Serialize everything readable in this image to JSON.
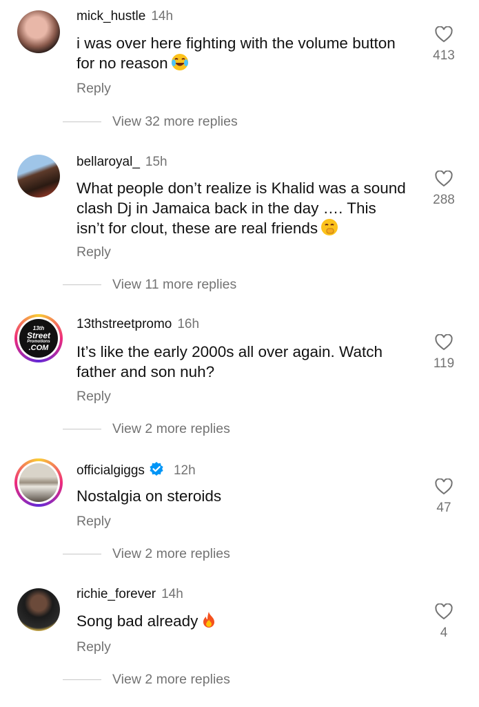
{
  "comments": [
    {
      "username": "mick_hustle",
      "time": "14h",
      "text": "i was over here fighting with the volume button for no reason",
      "emoji": "face-with-tears-of-joy",
      "reply": "Reply",
      "view_replies": "View 32 more replies",
      "likes": "413",
      "verified": false
    },
    {
      "username": "bellaroyal_",
      "time": "15h",
      "text": "What people don’t realize is Khalid was a sound clash Dj in Jamaica back in the day …. This isn’t for clout, these are real friends",
      "emoji": "face-with-hand-over-mouth",
      "reply": "Reply",
      "view_replies": "View 11 more replies",
      "likes": "288",
      "verified": false
    },
    {
      "username": "13thstreetpromo",
      "time": "16h",
      "text": "It’s like the early 2000s all over again. Watch father and son nuh?",
      "emoji": "",
      "reply": "Reply",
      "view_replies": "View 2 more replies",
      "likes": "119",
      "verified": false,
      "avatar_text": {
        "line1": "13th",
        "line2": "Street",
        "line3": "Promotions",
        "line4": ".COM"
      }
    },
    {
      "username": "officialgiggs",
      "time": "12h",
      "text": "Nostalgia on steroids",
      "emoji": "",
      "reply": "Reply",
      "view_replies": "View 2 more replies",
      "likes": "47",
      "verified": true
    },
    {
      "username": "richie_forever",
      "time": "14h",
      "text": "Song bad already",
      "emoji": "fire",
      "reply": "Reply",
      "view_replies": "View 2 more replies",
      "likes": "4",
      "verified": false
    }
  ],
  "colors": {
    "secondary_text": "#737373",
    "verified_blue": "#0095f6",
    "divider": "#c7c7c7"
  },
  "icons": {
    "like": "heart-outline-icon",
    "verified": "verified-badge-icon"
  }
}
